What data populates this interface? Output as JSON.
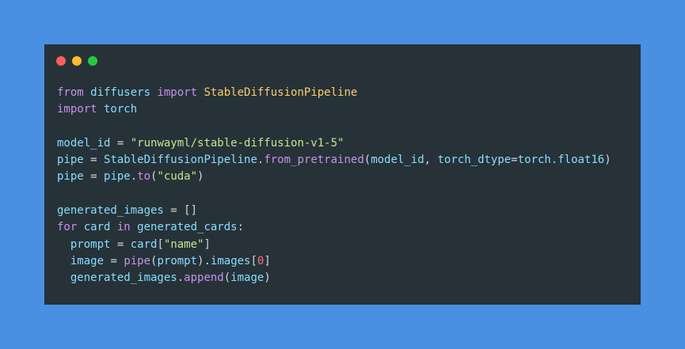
{
  "window": {
    "traffic_lights": {
      "close_color": "#ff5f56",
      "minimize_color": "#ffbd2e",
      "maximize_color": "#27c93f"
    }
  },
  "code": {
    "lines": [
      [
        {
          "t": "from",
          "c": "kw"
        },
        {
          "t": " diffusers ",
          "c": "id"
        },
        {
          "t": "import",
          "c": "kw"
        },
        {
          "t": " ",
          "c": "plain"
        },
        {
          "t": "StableDiffusionPipeline",
          "c": "cls"
        }
      ],
      [
        {
          "t": "import",
          "c": "kw"
        },
        {
          "t": " torch",
          "c": "id"
        }
      ],
      [],
      [
        {
          "t": "model_id",
          "c": "id"
        },
        {
          "t": " = ",
          "c": "plain"
        },
        {
          "t": "\"runwayml/stable-diffusion-v1-5\"",
          "c": "str"
        }
      ],
      [
        {
          "t": "pipe",
          "c": "id"
        },
        {
          "t": " = ",
          "c": "plain"
        },
        {
          "t": "StableDiffusionPipeline",
          "c": "id"
        },
        {
          "t": ".",
          "c": "plain"
        },
        {
          "t": "from_pretrained",
          "c": "fn"
        },
        {
          "t": "(",
          "c": "plain"
        },
        {
          "t": "model_id",
          "c": "id"
        },
        {
          "t": ", ",
          "c": "plain"
        },
        {
          "t": "torch_dtype",
          "c": "id"
        },
        {
          "t": "=",
          "c": "plain"
        },
        {
          "t": "torch.float16",
          "c": "id"
        },
        {
          "t": ")",
          "c": "plain"
        }
      ],
      [
        {
          "t": "pipe",
          "c": "id"
        },
        {
          "t": " = ",
          "c": "plain"
        },
        {
          "t": "pipe",
          "c": "id"
        },
        {
          "t": ".",
          "c": "plain"
        },
        {
          "t": "to",
          "c": "fn"
        },
        {
          "t": "(",
          "c": "plain"
        },
        {
          "t": "\"cuda\"",
          "c": "str"
        },
        {
          "t": ")",
          "c": "plain"
        }
      ],
      [],
      [
        {
          "t": "generated_images",
          "c": "id"
        },
        {
          "t": " = []",
          "c": "plain"
        }
      ],
      [
        {
          "t": "for",
          "c": "kw"
        },
        {
          "t": " card ",
          "c": "id"
        },
        {
          "t": "in",
          "c": "kw"
        },
        {
          "t": " generated_cards",
          "c": "id"
        },
        {
          "t": ":",
          "c": "plain"
        }
      ],
      [
        {
          "t": "  prompt",
          "c": "id"
        },
        {
          "t": " = ",
          "c": "plain"
        },
        {
          "t": "card",
          "c": "id"
        },
        {
          "t": "[",
          "c": "plain"
        },
        {
          "t": "\"name\"",
          "c": "str"
        },
        {
          "t": "]",
          "c": "plain"
        }
      ],
      [
        {
          "t": "  image",
          "c": "id"
        },
        {
          "t": " = ",
          "c": "plain"
        },
        {
          "t": "pipe",
          "c": "fn"
        },
        {
          "t": "(",
          "c": "plain"
        },
        {
          "t": "prompt",
          "c": "id"
        },
        {
          "t": ").",
          "c": "plain"
        },
        {
          "t": "images",
          "c": "id"
        },
        {
          "t": "[",
          "c": "plain"
        },
        {
          "t": "0",
          "c": "num"
        },
        {
          "t": "]",
          "c": "plain"
        }
      ],
      [
        {
          "t": "  generated_images",
          "c": "id"
        },
        {
          "t": ".",
          "c": "plain"
        },
        {
          "t": "append",
          "c": "fn"
        },
        {
          "t": "(",
          "c": "plain"
        },
        {
          "t": "image",
          "c": "id"
        },
        {
          "t": ")",
          "c": "plain"
        }
      ]
    ]
  }
}
